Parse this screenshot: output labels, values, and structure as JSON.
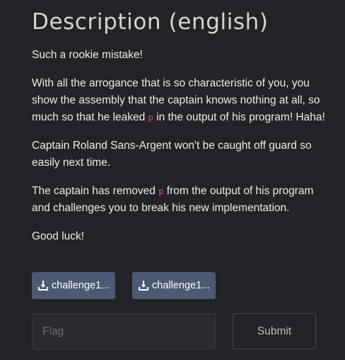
{
  "title": "Description (english)",
  "description": {
    "p1": "Such a rookie mistake!",
    "p2_part1": "With all the arrogance that is so characteristic of you, you show the assembly that the captain knows nothing at all, so much so that he leaked ",
    "p2_code": "p",
    "p2_part2": " in the output of his program! Haha!",
    "p3": "Captain Roland Sans-Argent won't be caught off guard so easily next time.",
    "p4_part1": "The captain has removed ",
    "p4_code": "p",
    "p4_part2": " from the output of his program and challenges you to break his new implementation.",
    "p5": "Good luck!"
  },
  "downloads": [
    {
      "label": "challenge1...",
      "icon": "download-icon"
    },
    {
      "label": "challenge1...",
      "icon": "download-icon"
    }
  ],
  "form": {
    "flag_placeholder": "Flag",
    "flag_value": "",
    "submit_label": "Submit"
  },
  "colors": {
    "background": "#222326",
    "button": "#4b5a72",
    "code": "#e83e8c"
  }
}
